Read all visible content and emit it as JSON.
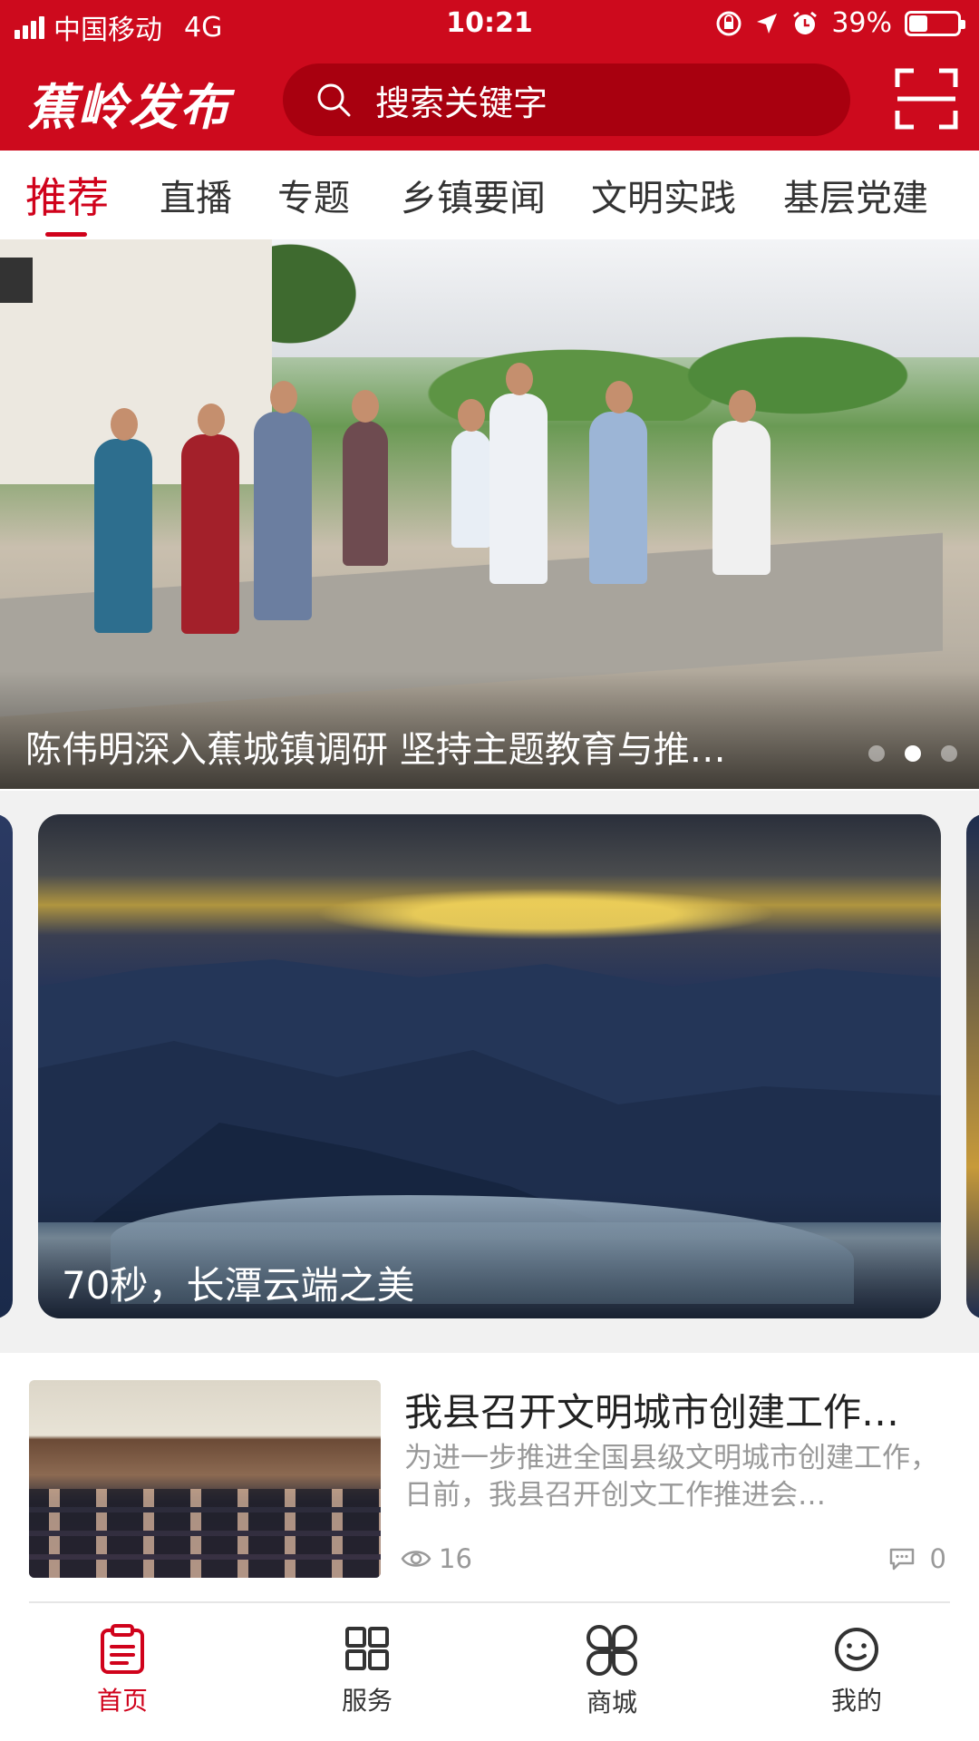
{
  "status_bar": {
    "carrier": "中国移动",
    "network": "4G",
    "time": "10:21",
    "battery_percent": "39%",
    "battery_level": 0.39
  },
  "app": {
    "logo": "蕉岭发布",
    "search_placeholder": "搜索关键字",
    "brand_color": "#cd0a1d",
    "accent_color": "#d0021b"
  },
  "tabs": [
    {
      "label": "推荐",
      "active": true
    },
    {
      "label": "直播",
      "active": false
    },
    {
      "label": "专题",
      "active": false
    },
    {
      "label": "乡镇要闻",
      "active": false
    },
    {
      "label": "文明实践",
      "active": false
    },
    {
      "label": "基层党建",
      "active": false
    }
  ],
  "carousel": {
    "caption": "陈伟明深入蕉城镇调研 坚持主题教育与推…",
    "dot_count": 3,
    "active_dot": 2
  },
  "video_card": {
    "caption": "70秒，长潭云端之美"
  },
  "news": [
    {
      "title": "我县召开文明城市创建工作…",
      "summary": "为进一步推进全国县级文明城市创建工作，日前，我县召开创文工作推进会…",
      "views": "16",
      "comments": "0"
    }
  ],
  "bottom_nav": [
    {
      "label": "首页",
      "icon": "clipboard-icon",
      "active": true
    },
    {
      "label": "服务",
      "icon": "grid-icon",
      "active": false
    },
    {
      "label": "商城",
      "icon": "clover-icon",
      "active": false
    },
    {
      "label": "我的",
      "icon": "smiley-icon",
      "active": false
    }
  ]
}
